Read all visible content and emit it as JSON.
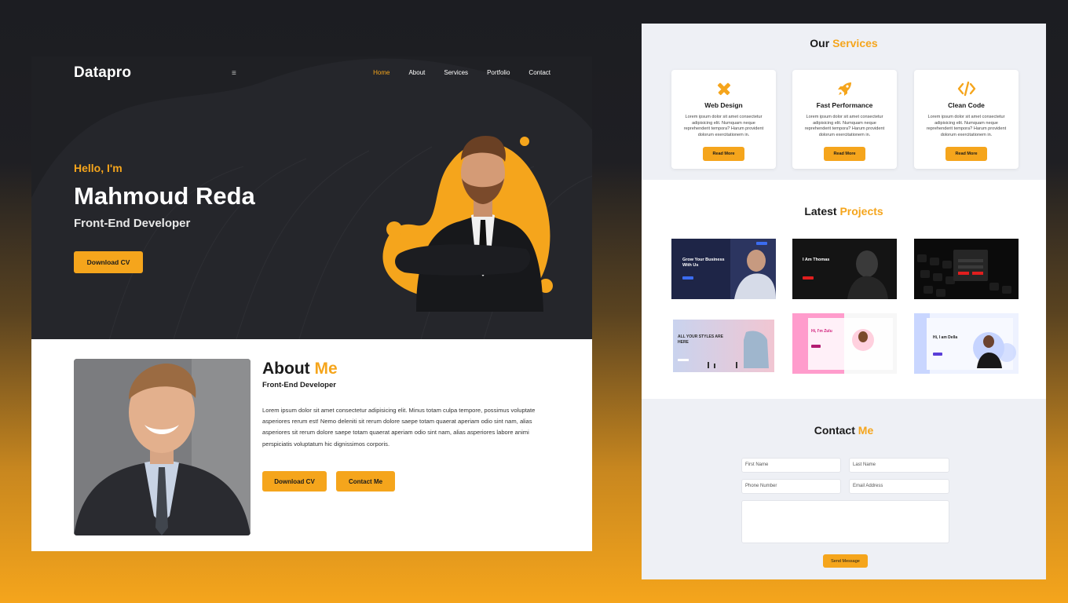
{
  "left": {
    "nav": {
      "logo": "Datapro",
      "menu_icon": "≡",
      "items": [
        "Home",
        "About",
        "Services",
        "Portfolio",
        "Contact"
      ]
    },
    "hero": {
      "greeting": "Hello, I'm",
      "name": "Mahmoud Reda",
      "role": "Front-End Developer",
      "cv_button": "Download CV"
    },
    "about": {
      "title_plain": "About",
      "title_accent": "Me",
      "subtitle": "Front-End Developer",
      "text": "Lorem ipsum dolor sit amet consectetur adipisicing elit. Minus totam culpa tempore, possimus voluptate asperiores rerum est! Nemo deleniti sit rerum dolore saepe totam quaerat aperiam odio sint nam, alias asperiores sit rerum dolore saepe totam quaerat aperiam odio sint nam, alias asperiores labore animi perspiciatis voluptatum hic dignissimos corporis.",
      "cv_button": "Download CV",
      "contact_button": "Contact Me"
    }
  },
  "right": {
    "services": {
      "title_plain": "Our",
      "title_accent": "Services",
      "cards": [
        {
          "icon": "pencil-ruler-icon",
          "name": "Web Design",
          "text": "Lorem ipsum dolor sit amet consectetur adipisicing elit. Numquam neque reprehenderit tempora? Harum provident dolorum exercitationem in.",
          "button": "Read More"
        },
        {
          "icon": "rocket-icon",
          "name": "Fast Performance",
          "text": "Lorem ipsum dolor sit amet consectetur adipisicing elit. Numquam neque reprehenderit tempora? Harum provident dolorum exercitationem in.",
          "button": "Read More"
        },
        {
          "icon": "code-icon",
          "name": "Clean Code",
          "text": "Lorem ipsum dolor sit amet consectetur adipisicing elit. Numquam neque reprehenderit tempora? Harum provident dolorum exercitationem in.",
          "button": "Read More"
        }
      ]
    },
    "projects": {
      "title_plain": "Latest",
      "title_accent": "Projects",
      "thumbs": [
        {
          "caption": "Grow Your Business With Us"
        },
        {
          "caption": "I Am Thomas"
        },
        {
          "caption": ""
        },
        {
          "caption": "ALL YOUR STYLES ARE HERE"
        },
        {
          "caption": "Hi, I'm Zulu"
        },
        {
          "caption": "Hi, I am Della"
        }
      ]
    },
    "contact": {
      "title_plain": "Contact",
      "title_accent": "Me",
      "first_name": "First Name",
      "last_name": "Last Name",
      "phone": "Phone Number",
      "email": "Email Address",
      "send": "Send Message"
    }
  },
  "colors": {
    "accent": "#f5a51c",
    "dark": "#1f2024",
    "light_bg": "#eef0f5"
  }
}
